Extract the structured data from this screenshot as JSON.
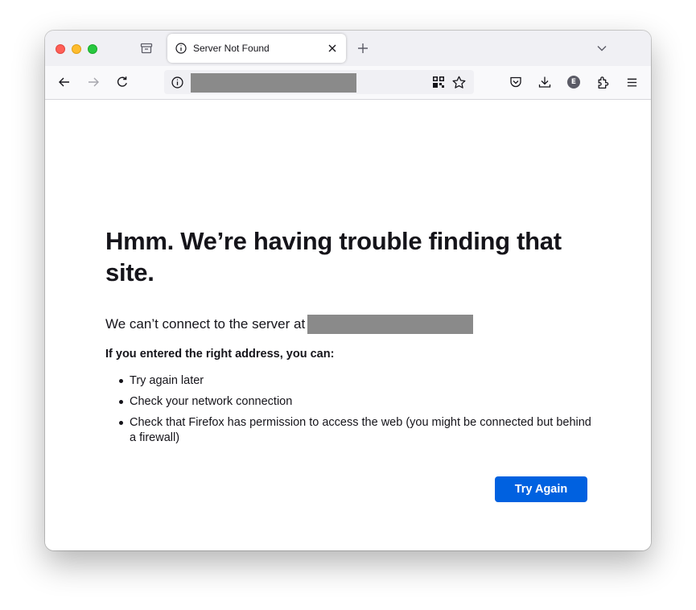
{
  "tab": {
    "title": "Server Not Found",
    "favicon": "info-icon"
  },
  "toolbar": {
    "url_redacted": true,
    "icons": [
      "back-arrow-icon",
      "forward-arrow-icon",
      "reload-icon",
      "site-info-icon",
      "qr-code-icon",
      "bookmark-star-icon",
      "pocket-icon",
      "downloads-icon",
      "account-avatar-icon",
      "extensions-icon",
      "menu-icon"
    ],
    "account_initial": "E"
  },
  "error": {
    "title": "Hmm. We’re having trouble finding that site.",
    "intro": "We can’t connect to the server at",
    "suggest_heading": "If you entered the right address, you can:",
    "suggestions": [
      "Try again later",
      "Check your network connection",
      "Check that Firefox has permission to access the web (you might be connected but behind a firewall)"
    ],
    "try_again_label": "Try Again"
  },
  "colors": {
    "accent_button": "#0061e0",
    "text_primary": "#15141a",
    "redaction": "#8a8a8a",
    "traffic_red": "#ff5f57",
    "traffic_yellow": "#febc2e",
    "traffic_green": "#28c840"
  }
}
